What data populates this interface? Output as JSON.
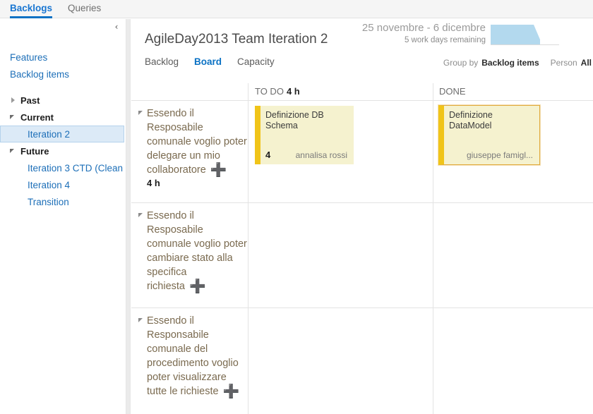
{
  "topbar": {
    "tabs": [
      {
        "label": "Backlogs",
        "active": true
      },
      {
        "label": "Queries",
        "active": false
      }
    ]
  },
  "sidebar": {
    "collapse_icon": "‹",
    "links": [
      {
        "label": "Features"
      },
      {
        "label": "Backlog items"
      }
    ],
    "tree": [
      {
        "label": "Past",
        "expanded": false,
        "children": []
      },
      {
        "label": "Current",
        "expanded": true,
        "children": [
          {
            "label": "Iteration 2",
            "selected": true
          }
        ]
      },
      {
        "label": "Future",
        "expanded": true,
        "children": [
          {
            "label": "Iteration 3 CTD (Clean ...",
            "selected": false
          },
          {
            "label": "Iteration 4",
            "selected": false
          },
          {
            "label": "Transition",
            "selected": false
          }
        ]
      }
    ]
  },
  "header": {
    "title": "AgileDay2013 Team Iteration 2",
    "date_range": "25 novembre - 6 dicembre",
    "days_remaining": "5 work days remaining",
    "sparkline_color": "#b3d9ee",
    "view_tabs": [
      {
        "label": "Backlog",
        "active": false
      },
      {
        "label": "Board",
        "active": true
      },
      {
        "label": "Capacity",
        "active": false
      }
    ],
    "filters": [
      {
        "label": "Group by",
        "value": "Backlog items"
      },
      {
        "label": "Person",
        "value": "All"
      }
    ]
  },
  "board": {
    "columns": [
      {
        "name": "TO DO",
        "hours": "4 h"
      },
      {
        "name": "DONE",
        "hours": ""
      }
    ],
    "rows": [
      {
        "pbi_title": "Essendo il Resposabile comunale voglio poter delegare un mio collaboratore",
        "pbi_effort": "4 h",
        "add_icon": "➕",
        "todo_cards": [
          {
            "title": "Definizione DB Schema",
            "points": "4",
            "owner": "annalisa rossi",
            "selected": false
          }
        ],
        "done_cards": [
          {
            "title": "Definizione DataModel",
            "points": "",
            "owner": "giuseppe famigl...",
            "selected": true
          }
        ]
      },
      {
        "pbi_title": "Essendo il Resposabile comunale voglio poter cambiare stato alla specifica richiesta",
        "pbi_effort": "",
        "add_icon": "➕",
        "todo_cards": [],
        "done_cards": []
      },
      {
        "pbi_title": "Essendo il Responsabile comunale del procedimento voglio poter visualizzare tutte le richieste",
        "pbi_effort": "",
        "add_icon": "➕",
        "todo_cards": [],
        "done_cards": []
      }
    ]
  }
}
